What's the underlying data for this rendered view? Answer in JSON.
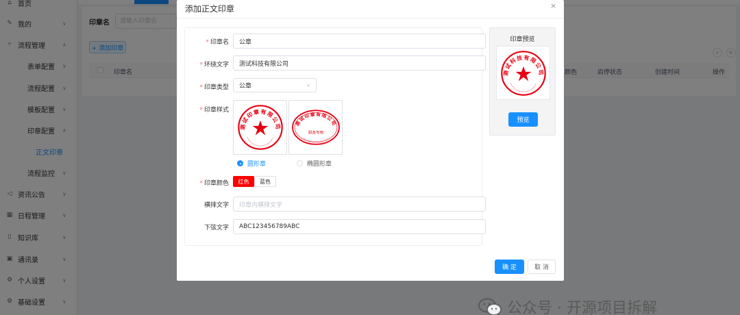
{
  "sidebar": {
    "items": [
      {
        "icon": "home-icon",
        "label": "首页",
        "expandable": false
      },
      {
        "icon": "edit-icon",
        "label": "我的",
        "expandable": true
      },
      {
        "icon": "flow-icon",
        "label": "流程管理",
        "expandable": true
      },
      {
        "label": "表单配置",
        "expandable": true
      },
      {
        "label": "流程配置",
        "expandable": true
      },
      {
        "label": "模板配置",
        "expandable": true
      },
      {
        "label": "印章配置",
        "expandable": true
      },
      {
        "label": "正文印章",
        "expandable": false,
        "active": true
      },
      {
        "label": "流程监控",
        "expandable": true
      },
      {
        "icon": "megaphone-icon",
        "label": "资讯公告",
        "expandable": true
      },
      {
        "icon": "calendar-icon",
        "label": "日程管理",
        "expandable": true
      },
      {
        "icon": "book-icon",
        "label": "知识库",
        "expandable": true
      },
      {
        "icon": "contacts-icon",
        "label": "通讯录",
        "expandable": true
      },
      {
        "icon": "user-settings-icon",
        "label": "个人设置",
        "expandable": true
      },
      {
        "icon": "settings-icon",
        "label": "基础设置",
        "expandable": true
      }
    ]
  },
  "page": {
    "search_label": "印章名",
    "search_placeholder": "请输入印章名",
    "add_button": "+ 添加印章",
    "columns": [
      "印章名",
      "颜色",
      "启停状态",
      "创建时间",
      "操作"
    ]
  },
  "dialog": {
    "title": "添加正文印章",
    "close": "×",
    "fields": {
      "name_label": "印章名",
      "name_value": "公章",
      "ring_label": "环绕文字",
      "ring_value": "测试科技有限公司",
      "type_label": "印章类型",
      "type_value": "公章",
      "style_label": "印章样式",
      "style_options": [
        "圆形章",
        "椭圆形章"
      ],
      "style_selected": "圆形章",
      "color_label": "印章颜色",
      "color_options": [
        "红色",
        "蓝色"
      ],
      "color_selected": "红色",
      "horizontal_label": "横排文字",
      "horizontal_placeholder": "印章内横排文字",
      "bottom_label": "下弦文字",
      "bottom_value": "ABC123456789ABC"
    },
    "stamp_samples": {
      "round_text": "测试印章有限公司",
      "oval_text": "测试印章有限公司",
      "oval_inner_text": "财务专用"
    },
    "preview": {
      "title": "印章预览",
      "stamp_text": "测试科技有限公司",
      "button": "预览"
    },
    "ok_button": "确 定",
    "cancel_button": "取 消"
  },
  "watermark": {
    "text": "公众号 · 开源项目拆解"
  },
  "colors": {
    "primary": "#1890ff",
    "stamp_red": "#e60012",
    "required": "#f56c6c"
  }
}
